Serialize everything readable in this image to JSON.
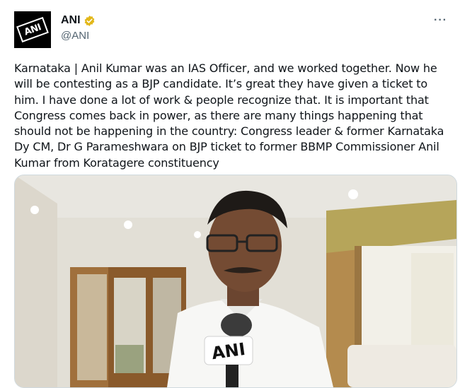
{
  "author": {
    "display_name": "ANI",
    "handle": "@ANI",
    "avatar_logo_text": "ANI",
    "verified": true,
    "verified_color": "#e2b719"
  },
  "tweet": {
    "text": "Karnataka | Anil Kumar was an IAS Officer, and we worked together. Now he will be contesting as a BJP candidate. It’s great they have given a ticket to him. I have done a lot of work & people recognize that. It is important that Congress comes back in power, as there are many things happening that should not be happening in the country: Congress leader & former Karnataka Dy CM, Dr G Parameshwara on BJP ticket to former BBMP Commissioner Anil Kumar from Koratagere constituency"
  },
  "menu": {
    "more_label": "···"
  },
  "media": {
    "microphone_logo_text": "ANI",
    "icons": [
      "more-options-icon",
      "verified-badge-icon",
      "microphone-icon"
    ]
  },
  "colors": {
    "text_primary": "#0f1419",
    "text_secondary": "#536471",
    "border": "#cfd9de"
  }
}
